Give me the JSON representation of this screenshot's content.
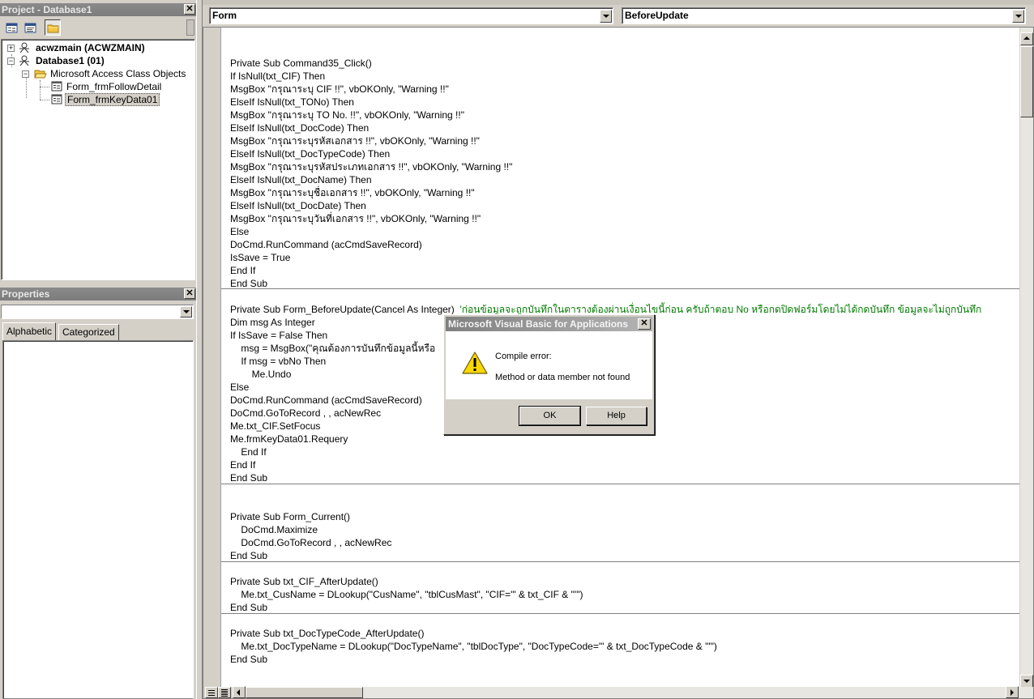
{
  "project_panel": {
    "title": "Project - Database1",
    "tree": [
      {
        "label": "acwzmain (ACWZMAIN)",
        "expander": "+"
      },
      {
        "label": "Database1 (01)",
        "expander": "−"
      },
      {
        "label": "Microsoft Access Class Objects",
        "expander": "−"
      },
      {
        "label": "Form_frmFollowDetail"
      },
      {
        "label": "Form_frmKeyData01",
        "selected": true
      }
    ]
  },
  "properties_panel": {
    "title": "Properties",
    "combo_value": "",
    "tabs": [
      "Alphabetic",
      "Categorized"
    ]
  },
  "code_window": {
    "object_dropdown": "Form",
    "procedure_dropdown": "BeforeUpdate",
    "lines": [
      "Private Sub Command35_Click()",
      "If IsNull(txt_CIF) Then",
      "MsgBox \"กรุณาระบุ CIF !!\", vbOKOnly, \"Warning !!\"",
      "ElseIf IsNull(txt_TONo) Then",
      "MsgBox \"กรุณาระบุ TO No. !!\", vbOKOnly, \"Warning !!\"",
      "ElseIf IsNull(txt_DocCode) Then",
      "MsgBox \"กรุณาระบุรหัสเอกสาร !!\", vbOKOnly, \"Warning !!\"",
      "ElseIf IsNull(txt_DocTypeCode) Then",
      "MsgBox \"กรุณาระบุรหัสประเภทเอกสาร !!\", vbOKOnly, \"Warning !!\"",
      "ElseIf IsNull(txt_DocName) Then",
      "MsgBox \"กรุณาระบุชื่อเอกสาร !!\", vbOKOnly, \"Warning !!\"",
      "ElseIf IsNull(txt_DocDate) Then",
      "MsgBox \"กรุณาระบุวันที่เอกสาร !!\", vbOKOnly, \"Warning !!\"",
      "Else",
      "DoCmd.RunCommand (acCmdSaveRecord)",
      "IsSave = True",
      "End If",
      "End Sub",
      "Private Sub Form_BeforeUpdate(Cancel As Integer)",
      "Dim msg As Integer",
      "If IsSave = False Then",
      "    msg = MsgBox(\"คุณต้องการบันทึกข้อมูลนี้หรือ",
      "    If msg = vbNo Then",
      "        Me.Undo",
      "Else",
      "DoCmd.RunCommand (acCmdSaveRecord)",
      "DoCmd.GoToRecord , , acNewRec",
      "Me.txt_CIF.SetFocus",
      "Me.frmKeyData01.Requery",
      "    End If",
      "End If",
      "End Sub",
      "Private Sub Form_Current()",
      "    DoCmd.Maximize",
      "    DoCmd.GoToRecord , , acNewRec",
      "End Sub",
      "Private Sub txt_CIF_AfterUpdate()",
      "    Me.txt_CusName = DLookup(\"CusName\", \"tblCusMast\", \"CIF='\" & txt_CIF & \"'\")",
      "End Sub",
      "Private Sub txt_DocTypeCode_AfterUpdate()",
      "    Me.txt_DocTypeName = DLookup(\"DocTypeName\", \"tblDocType\", \"DocTypeCode='\" & txt_DocTypeCode & \"'\")",
      "End Sub"
    ],
    "comment": "'ก่อนข้อมูลจะถูกบันทึกในตารางต้องผ่านเงื่อนไขนี้ก่อน ครับถ้าตอบ No หรือกดปิดฟอร์มโดยไม่ได้กดบันทึก ข้อมูลจะไม่ถูกบันทึก"
  },
  "dialog": {
    "title": "Microsoft Visual Basic for Applications",
    "line1": "Compile error:",
    "line2": "Method or data member not found",
    "ok_label": "OK",
    "help_label": "Help",
    "icon": "warning-icon"
  },
  "icons": {
    "close": "close-icon",
    "view_object": "view-object-icon",
    "view_code": "view-code-icon",
    "toggle_folders": "folder-icon",
    "project": "vba-project-icon",
    "form_module": "form-module-icon"
  }
}
